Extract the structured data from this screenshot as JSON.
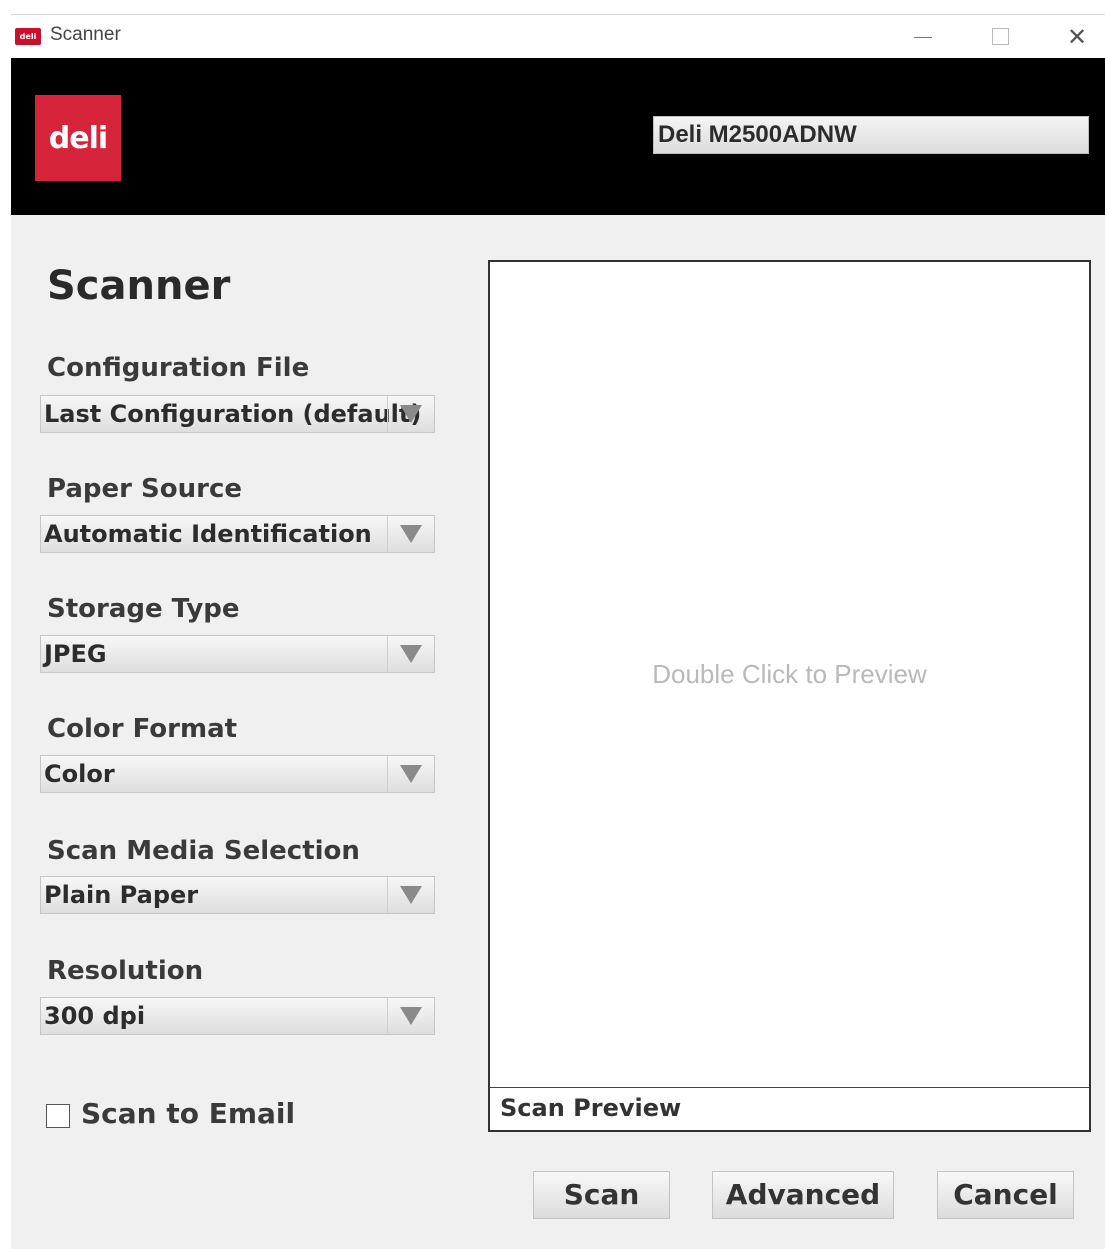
{
  "window": {
    "title": "Scanner",
    "app_icon": "deli-app-icon",
    "app_icon_text": "deli",
    "controls": [
      "minimize-icon",
      "maximize-icon",
      "close-icon"
    ],
    "close_glyph": "✕"
  },
  "header": {
    "logo_text": "deli",
    "brand_color": "#d6243a",
    "device": "Deli M2500ADNW"
  },
  "form": {
    "title": "Scanner",
    "fields": [
      {
        "label": "Configuration File",
        "value": "Last Configuration (default)"
      },
      {
        "label": "Paper Source",
        "value": "Automatic Identification"
      },
      {
        "label": "Storage Type",
        "value": "JPEG"
      },
      {
        "label": "Color Format",
        "value": "Color"
      },
      {
        "label": "Scan Media Selection",
        "value": "Plain Paper"
      },
      {
        "label": "Resolution",
        "value": "300 dpi"
      }
    ],
    "scan_to_email": {
      "label": "Scan to Email",
      "checked": false
    }
  },
  "preview": {
    "hint": "Double Click to Preview",
    "footer": "Scan Preview"
  },
  "buttons": {
    "scan": "Scan",
    "advanced": "Advanced",
    "cancel": "Cancel"
  }
}
